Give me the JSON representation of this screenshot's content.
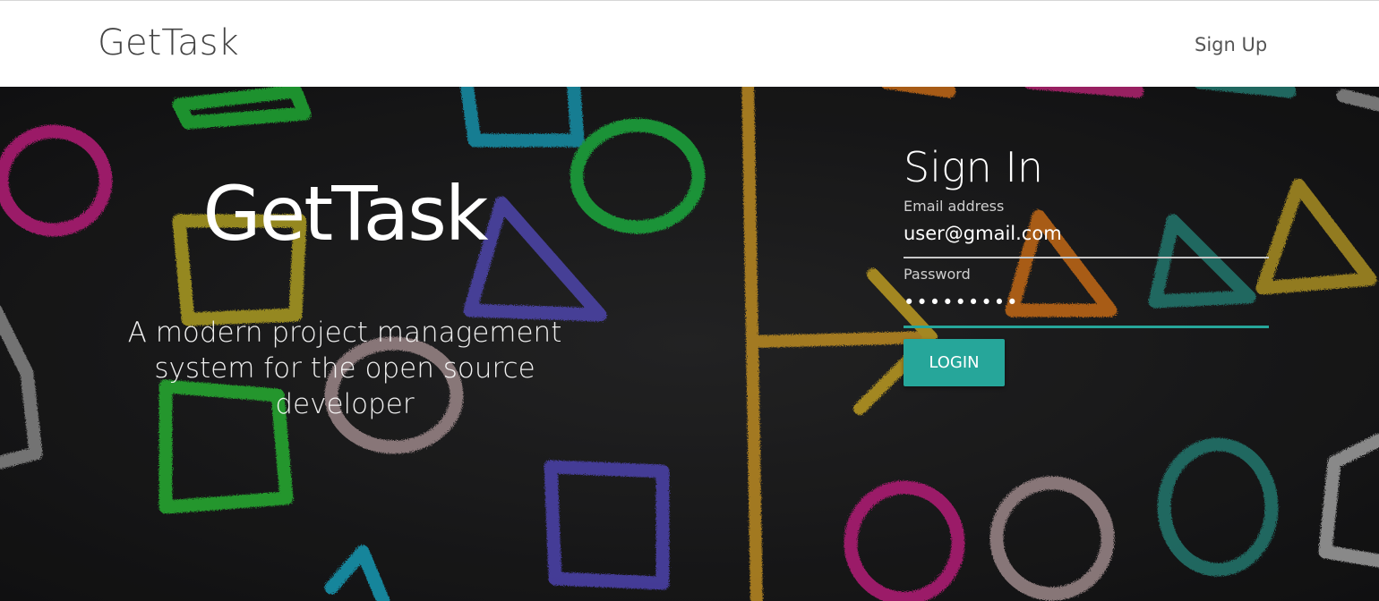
{
  "navbar": {
    "brand": "GetTask",
    "signup_link": "Sign Up"
  },
  "hero": {
    "title": "GetTask",
    "tagline": "A modern project management system for the open source developer"
  },
  "signin": {
    "title": "Sign In",
    "email_label": "Email address",
    "email_value": "user@gmail.com",
    "password_label": "Password",
    "password_value": "•••••••••",
    "login_button": "LOGIN"
  },
  "colors": {
    "accent": "#26a69a",
    "background": "#1c1c1d",
    "navbar": "#ffffff"
  }
}
